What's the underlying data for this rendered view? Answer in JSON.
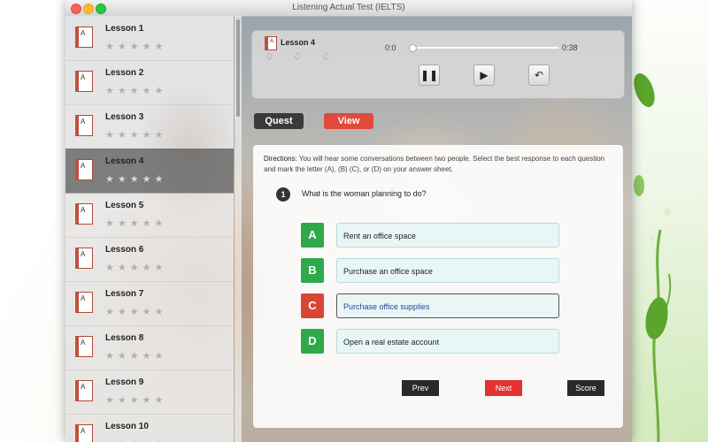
{
  "window": {
    "title": "Listening Actual Test (IELTS)"
  },
  "sidebar": {
    "lessons": [
      {
        "label": "Lesson 1"
      },
      {
        "label": "Lesson 2"
      },
      {
        "label": "Lesson 3"
      },
      {
        "label": "Lesson 4",
        "active": true
      },
      {
        "label": "Lesson 5"
      },
      {
        "label": "Lesson 6"
      },
      {
        "label": "Lesson 7"
      },
      {
        "label": "Lesson 8"
      },
      {
        "label": "Lesson 9"
      },
      {
        "label": "Lesson 10"
      }
    ],
    "star_count": 5,
    "star_rating": 0
  },
  "player": {
    "title": "Lesson 4",
    "time_current": "0:0",
    "time_total": "0:38",
    "progress": 0,
    "buttons": [
      "pause-icon",
      "play-icon",
      "undo-icon"
    ]
  },
  "tabs": {
    "quest": "Quest",
    "view": "View"
  },
  "question": {
    "directions_label": "Directions:",
    "directions_text": "You will hear some conversations between two people. Select the best response to each question and mark the letter (A), (B) (C), or (D) on your answer sheet.",
    "number": "1",
    "text": "What is the woman planning to do?",
    "options": [
      {
        "letter": "A",
        "text": "Rent an office space"
      },
      {
        "letter": "B",
        "text": "Purchase an office space"
      },
      {
        "letter": "C",
        "text": "Purchase office supplies",
        "selected": true
      },
      {
        "letter": "D",
        "text": "Open a real estate account"
      }
    ]
  },
  "nav": {
    "prev": "Prev",
    "next": "Next",
    "score": "Score"
  },
  "colors": {
    "accent_red": "#e14a3a",
    "option_green": "#2eaa4a",
    "dark_button": "#2a2a2a"
  }
}
